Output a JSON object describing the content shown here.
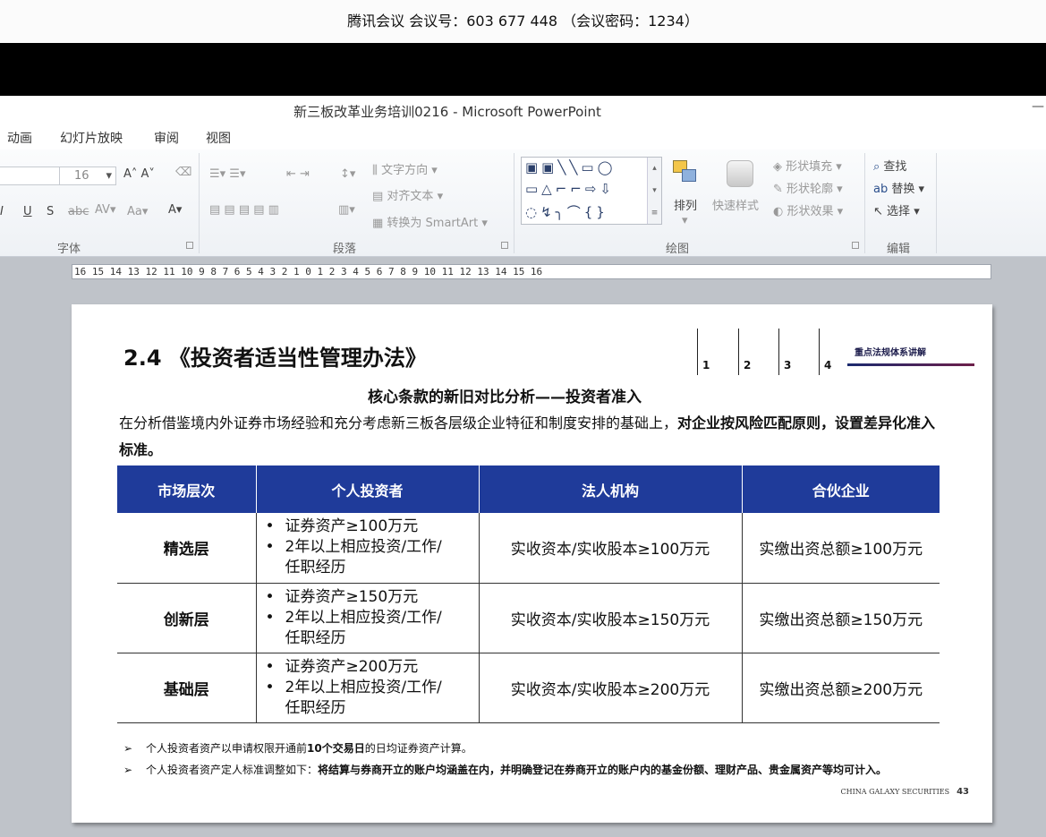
{
  "meeting": {
    "text": "腾讯会议 会议号：603 677 448 （会议密码：1234）"
  },
  "app": {
    "title": "新三板改革业务培训0216 - Microsoft PowerPoint"
  },
  "tabs": [
    "动画",
    "幻灯片放映",
    "审阅",
    "视图"
  ],
  "ribbon": {
    "font": {
      "size": "16",
      "group_label": "字体"
    },
    "paragraph": {
      "text_direction": "文字方向",
      "align_text": "对齐文本",
      "convert_smartart": "转换为 SmartArt",
      "group_label": "段落"
    },
    "drawing": {
      "arrange": "排列",
      "quick_styles": "快速样式",
      "shape_fill": "形状填充",
      "shape_outline": "形状轮廓",
      "shape_effects": "形状效果",
      "group_label": "绘图"
    },
    "editing": {
      "find": "查找",
      "replace": "替换",
      "select": "选择",
      "group_label": "编辑"
    }
  },
  "ruler": {
    "text": "16 15 14 13 12 11 10 9 8 7 6 5 4 3 2 1 0 1 2 3 4 5 6 7 8 9 10 11 12 13 14 15 16"
  },
  "slide": {
    "title": "2.4 《投资者适当性管理办法》",
    "nav": {
      "numbers": [
        "1",
        "2",
        "3",
        "4"
      ],
      "label": "重点法规体系讲解"
    },
    "subtitle": "核心条款的新旧对比分析——投资者准入",
    "intro_plain": "在分析借鉴境内外证券市场经验和充分考虑新三板各层级企业特征和制度安排的基础上，",
    "intro_bold": "对企业按风险匹配原则，设置差异化准入标准。",
    "table": {
      "headers": [
        "市场层次",
        "个人投资者",
        "法人机构",
        "合伙企业"
      ],
      "rows": [
        {
          "level": "精选层",
          "b1": "证券资产≥100万元",
          "b2": "2年以上相应投资/工作/",
          "b3": "任职经历",
          "legal": "实收资本/实收股本≥100万元",
          "partner": "实缴出资总额≥100万元"
        },
        {
          "level": "创新层",
          "b1": "证券资产≥150万元",
          "b2": "2年以上相应投资/工作/",
          "b3": "任职经历",
          "legal": "实收资本/实收股本≥150万元",
          "partner": "实缴出资总额≥150万元"
        },
        {
          "level": "基础层",
          "b1": "证券资产≥200万元",
          "b2": "2年以上相应投资/工作/",
          "b3": "任职经历",
          "legal": "实收资本/实收股本≥200万元",
          "partner": "实缴出资总额≥200万元"
        }
      ]
    },
    "notes": [
      {
        "pre": "个人投资者资产以申请权限开通前",
        "bold": "10个交易日",
        "post": "的日均证券资产计算。"
      },
      {
        "pre": "个人投资者资产定人标准调整如下：",
        "bold": "将结算与券商开立的账户均涵盖在内，并明确登记在券商开立的账户内的基金份额、理财产品、贵金属资产等均可计入。",
        "post": ""
      }
    ],
    "footer": {
      "brand": "CHINA GALAXY SECURITIES",
      "page": "43"
    }
  }
}
